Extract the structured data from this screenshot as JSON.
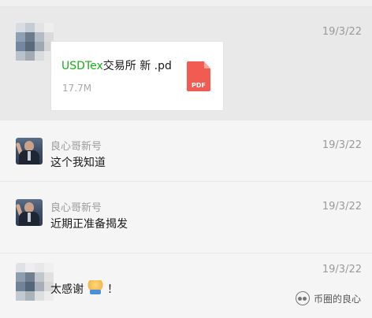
{
  "messages": [
    {
      "date": "19/3/22",
      "file": {
        "name_green": "USDTex",
        "name_rest": "交易所 新 .pd",
        "size": "17.7M",
        "icon_label": "PDF"
      }
    },
    {
      "date": "19/3/22",
      "sender": "良心哥新号",
      "text": "这个我知道"
    },
    {
      "date": "19/3/22",
      "sender": "良心哥新号",
      "text": "近期正准备揭发"
    },
    {
      "date": "19/3/22",
      "text_before": "太感谢",
      "text_after": "！"
    }
  ],
  "watermark": {
    "label": "币圈的良心"
  },
  "colors": {
    "accent_green": "#1aad19",
    "pdf_red": "#f15b51",
    "highlight_bg": "#e9e9e9"
  }
}
